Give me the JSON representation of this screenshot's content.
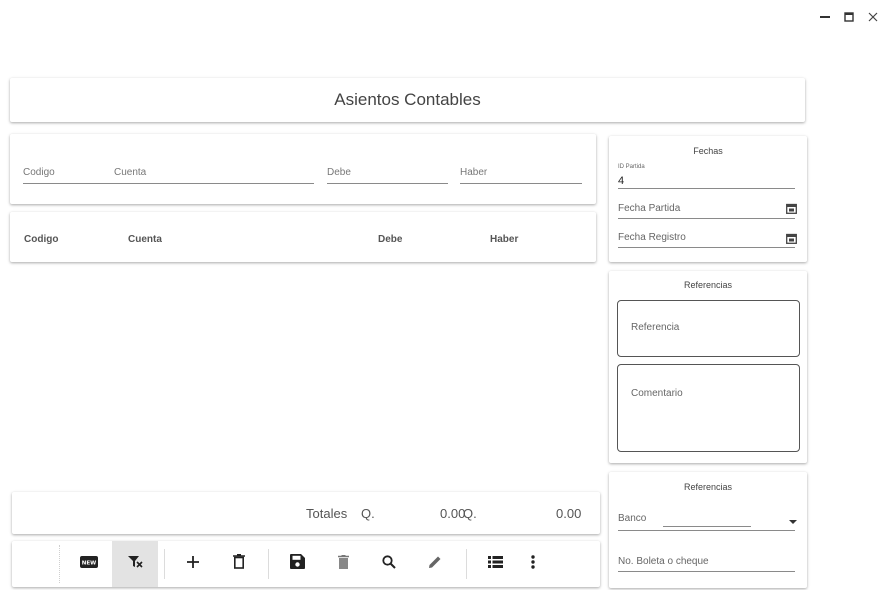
{
  "window": {
    "controls": [
      {
        "name": "minimize",
        "glyph": "minimize-icon"
      },
      {
        "name": "maximize",
        "glyph": "maximize-icon"
      },
      {
        "name": "close",
        "glyph": "close-icon"
      }
    ]
  },
  "header": {
    "title": "Asientos Contables"
  },
  "entry": {
    "codigo": "Codigo",
    "cuenta": "Cuenta",
    "debe": "Debe",
    "haber": "Haber"
  },
  "grid": {
    "columns": [
      "Codigo",
      "Cuenta",
      "Debe",
      "Haber"
    ],
    "rows": []
  },
  "totals": {
    "label": "Totales",
    "debe_currency": "Q.",
    "debe_value": "0.00",
    "haber_currency": "Q.",
    "haber_value": "0.00"
  },
  "toolbar": {
    "buttons": [
      "new-icon",
      "clear-filter-icon",
      "add-icon",
      "delete-outline-icon",
      "save-icon",
      "trash-icon",
      "search-icon",
      "edit-icon",
      "list-icon",
      "more-vertical-icon"
    ]
  },
  "fechas": {
    "title": "Fechas",
    "id_label": "ID Partida",
    "id_value": "4",
    "fecha_partida": "Fecha Partida",
    "fecha_registro": "Fecha Registro"
  },
  "referencias": {
    "title": "Referencias",
    "referencia": "Referencia",
    "comentario": "Comentario"
  },
  "banco_section": {
    "title": "Referencias",
    "banco": "Banco",
    "boleta": "No. Boleta o cheque"
  },
  "colors": {
    "accent": "#333333",
    "active_button": "#e3e3e3"
  }
}
